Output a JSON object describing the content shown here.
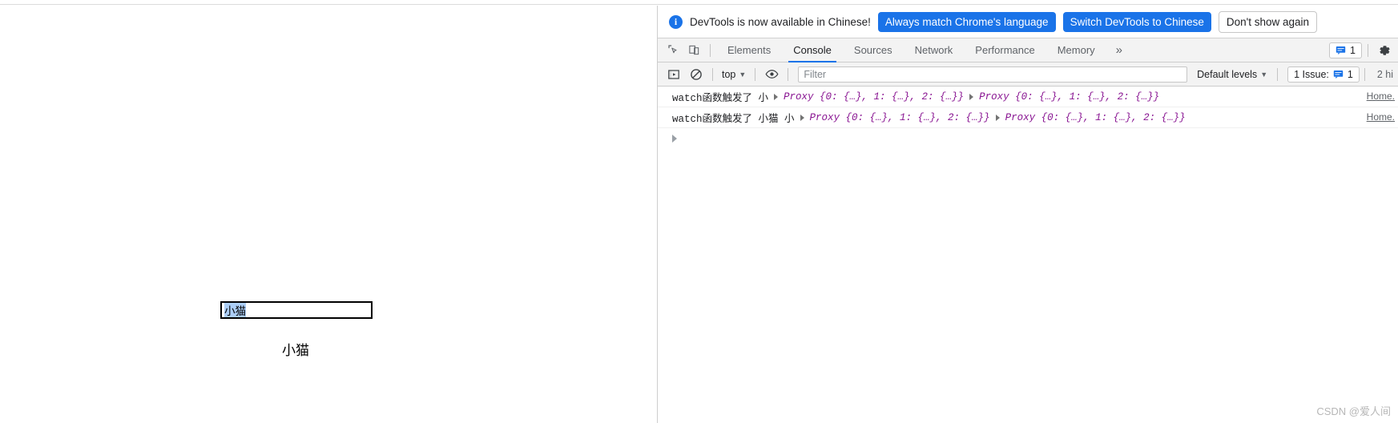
{
  "browser": {
    "strip_icons": [
      "tab-icon",
      "tab-icon",
      "tab-icon",
      "tab-icon",
      "tab-icon",
      "tab-icon",
      "tab-icon",
      "tab-icon",
      "tab-icon",
      "tab-icon"
    ]
  },
  "page": {
    "input_value": "小猫",
    "input_placeholder": "",
    "output_text": "小猫"
  },
  "devtools": {
    "infobar": {
      "icon": "info-icon",
      "message": "DevTools is now available in Chinese!",
      "primary_button": "Always match Chrome's language",
      "secondary_button": "Switch DevTools to Chinese",
      "dismiss_button": "Don't show again"
    },
    "tabbar": {
      "inspect_icon": "inspect-element-icon",
      "device_icon": "device-toolbar-icon",
      "tabs": [
        {
          "label": "Elements",
          "active": false
        },
        {
          "label": "Console",
          "active": true
        },
        {
          "label": "Sources",
          "active": false
        },
        {
          "label": "Network",
          "active": false
        },
        {
          "label": "Performance",
          "active": false
        },
        {
          "label": "Memory",
          "active": false
        }
      ],
      "more_tabs": "»",
      "issues_count": "1",
      "issues_icon": "issue-message-icon",
      "settings_icon": "gear-icon"
    },
    "console_toolbar": {
      "sidebar_icon": "console-sidebar-icon",
      "clear_icon": "clear-console-icon",
      "context": "top",
      "eye_icon": "live-expression-eye-icon",
      "filter_placeholder": "Filter",
      "filter_value": "",
      "levels": "Default levels",
      "issue_label": "1 Issue:",
      "issue_count": "1",
      "hidden_label": "2 hi"
    },
    "console": {
      "logs": [
        {
          "message": "watch函数触发了  小",
          "objects": [
            "Proxy {0: {…}, 1: {…}, 2: {…}}",
            "Proxy {0: {…}, 1: {…}, 2: {…}}"
          ],
          "source": "Home."
        },
        {
          "message": "watch函数触发了  小猫  小",
          "objects": [
            "Proxy {0: {…}, 1: {…}, 2: {…}}",
            "Proxy {0: {…}, 1: {…}, 2: {…}}"
          ],
          "source": "Home."
        }
      ],
      "prompt": ""
    }
  },
  "watermark": "CSDN @爱人间",
  "colors": {
    "accent_blue": "#1a73e8",
    "object_purple": "#881391",
    "text_primary": "#202124",
    "text_secondary": "#5f6368",
    "toolbar_bg": "#f3f3f3",
    "border": "#cdcdcd"
  }
}
